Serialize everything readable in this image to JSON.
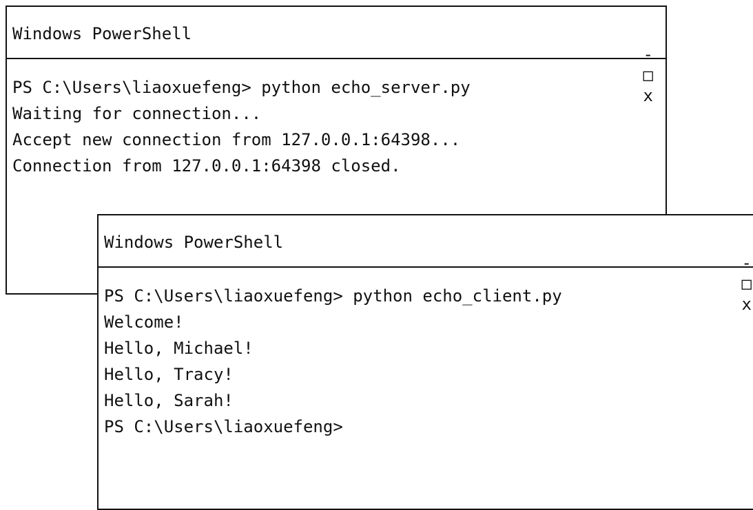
{
  "colors": {
    "border": "#111111",
    "background": "#ffffff",
    "text": "#111111"
  },
  "server_window": {
    "title": "Windows PowerShell",
    "controls": {
      "minimize": "-",
      "maximize": "□",
      "close": "x",
      "minimize_icon": "minimize-icon",
      "maximize_icon": "maximize-icon",
      "close_icon": "close-icon"
    },
    "lines": [
      "PS C:\\Users\\liaoxuefeng> python echo_server.py",
      "Waiting for connection...",
      "Accept new connection from 127.0.0.1:64398...",
      "Connection from 127.0.0.1:64398 closed."
    ]
  },
  "client_window": {
    "title": "Windows PowerShell",
    "controls": {
      "minimize": "-",
      "maximize": "□",
      "close": "x",
      "minimize_icon": "minimize-icon",
      "maximize_icon": "maximize-icon",
      "close_icon": "close-icon"
    },
    "lines": [
      "PS C:\\Users\\liaoxuefeng> python echo_client.py",
      "Welcome!",
      "Hello, Michael!",
      "Hello, Tracy!",
      "Hello, Sarah!",
      "PS C:\\Users\\liaoxuefeng>"
    ]
  }
}
